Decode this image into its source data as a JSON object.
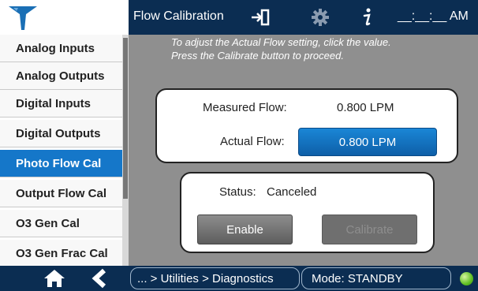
{
  "header": {
    "title": "Flow Calibration",
    "time": "__:__:__ AM"
  },
  "sidebar": {
    "items": [
      {
        "label": "Analog Inputs",
        "active": false
      },
      {
        "label": "Analog Outputs",
        "active": false
      },
      {
        "label": "Digital Inputs",
        "active": false
      },
      {
        "label": "Digital Outputs",
        "active": false
      },
      {
        "label": "Photo Flow Cal",
        "active": true
      },
      {
        "label": "Output Flow Cal",
        "active": false
      },
      {
        "label": "O3 Gen Cal",
        "active": false
      },
      {
        "label": "O3 Gen Frac Cal",
        "active": false
      }
    ]
  },
  "main": {
    "instruction_line1": "To adjust the Actual Flow setting, click the value.",
    "instruction_line2": "Press the Calibrate button to proceed.",
    "measured_flow_label": "Measured Flow:",
    "measured_flow_value": "0.800 LPM",
    "actual_flow_label": "Actual Flow:",
    "actual_flow_value": "0.800 LPM",
    "status_label": "Status:",
    "status_value": "Canceled",
    "enable_label": "Enable",
    "calibrate_label": "Calibrate"
  },
  "footer": {
    "breadcrumb": "... > Utilities > Diagnostics",
    "mode": "Mode: STANDBY"
  },
  "colors": {
    "header_bg": "#0b2d52",
    "active_item": "#1577c9",
    "panel_bg": "#8f8f8f",
    "status_led": "#5fbf22"
  },
  "icons": [
    "logo-icon",
    "login-icon",
    "gear-icon",
    "info-icon",
    "home-icon",
    "back-icon",
    "status-led-icon"
  ]
}
